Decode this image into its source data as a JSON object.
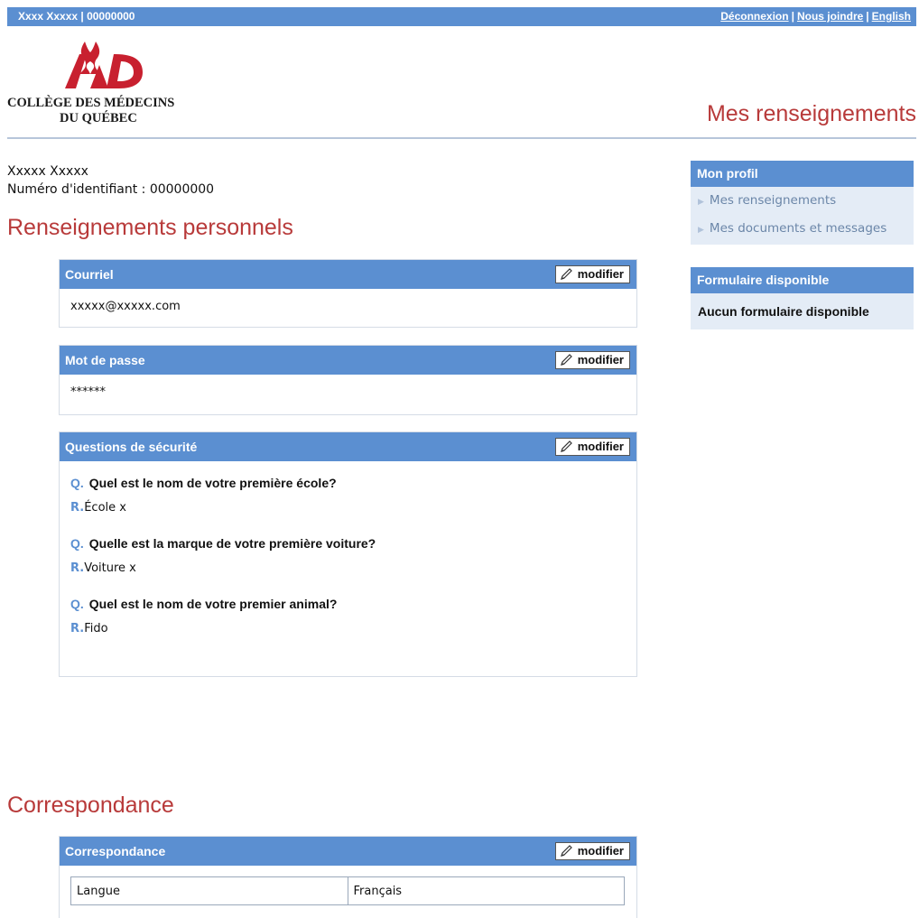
{
  "topbar": {
    "user": "Xxxx Xxxxx | 00000000",
    "links": [
      "Déconnexion",
      "Nous joindre",
      "English"
    ],
    "separator": "|"
  },
  "logo": {
    "line1": "COLLÈGE DES MÉDECINS",
    "line2": "DU QUÉBEC"
  },
  "page_title": "Mes renseignements",
  "user": {
    "name": "Xxxxx Xxxxx",
    "id_line": "Numéro d'identifiant : 00000000"
  },
  "sections": {
    "personal_title": "Renseignements personnels",
    "correspondence_title": "Correspondance"
  },
  "edit_label": "modifier",
  "panels": {
    "email": {
      "title": "Courriel",
      "value": "xxxxx@xxxxx.com"
    },
    "password": {
      "title": "Mot de passe",
      "value": "******"
    },
    "security": {
      "title": "Questions de sécurité",
      "q_prefix": "Q.",
      "a_prefix": "R.",
      "items": [
        {
          "q": "Quel est le nom de votre première école?",
          "a": "École x"
        },
        {
          "q": "Quelle est la marque de votre première voiture?",
          "a": "Voiture x"
        },
        {
          "q": "Quel est le nom de votre premier animal?",
          "a": "Fido"
        }
      ]
    },
    "correspondence": {
      "title": "Correspondance",
      "rows": [
        {
          "label": "Langue",
          "value": "Français"
        }
      ]
    }
  },
  "sidebar": {
    "profile": {
      "title": "Mon profil",
      "items": [
        "Mes renseignements",
        "Mes documents et messages"
      ]
    },
    "forms": {
      "title": "Formulaire disponible",
      "text": "Aucun formulaire disponible"
    }
  },
  "colors": {
    "brand_blue": "#5b8fd1",
    "heading_red": "#b83a3a",
    "logo_red": "#c8202f"
  }
}
